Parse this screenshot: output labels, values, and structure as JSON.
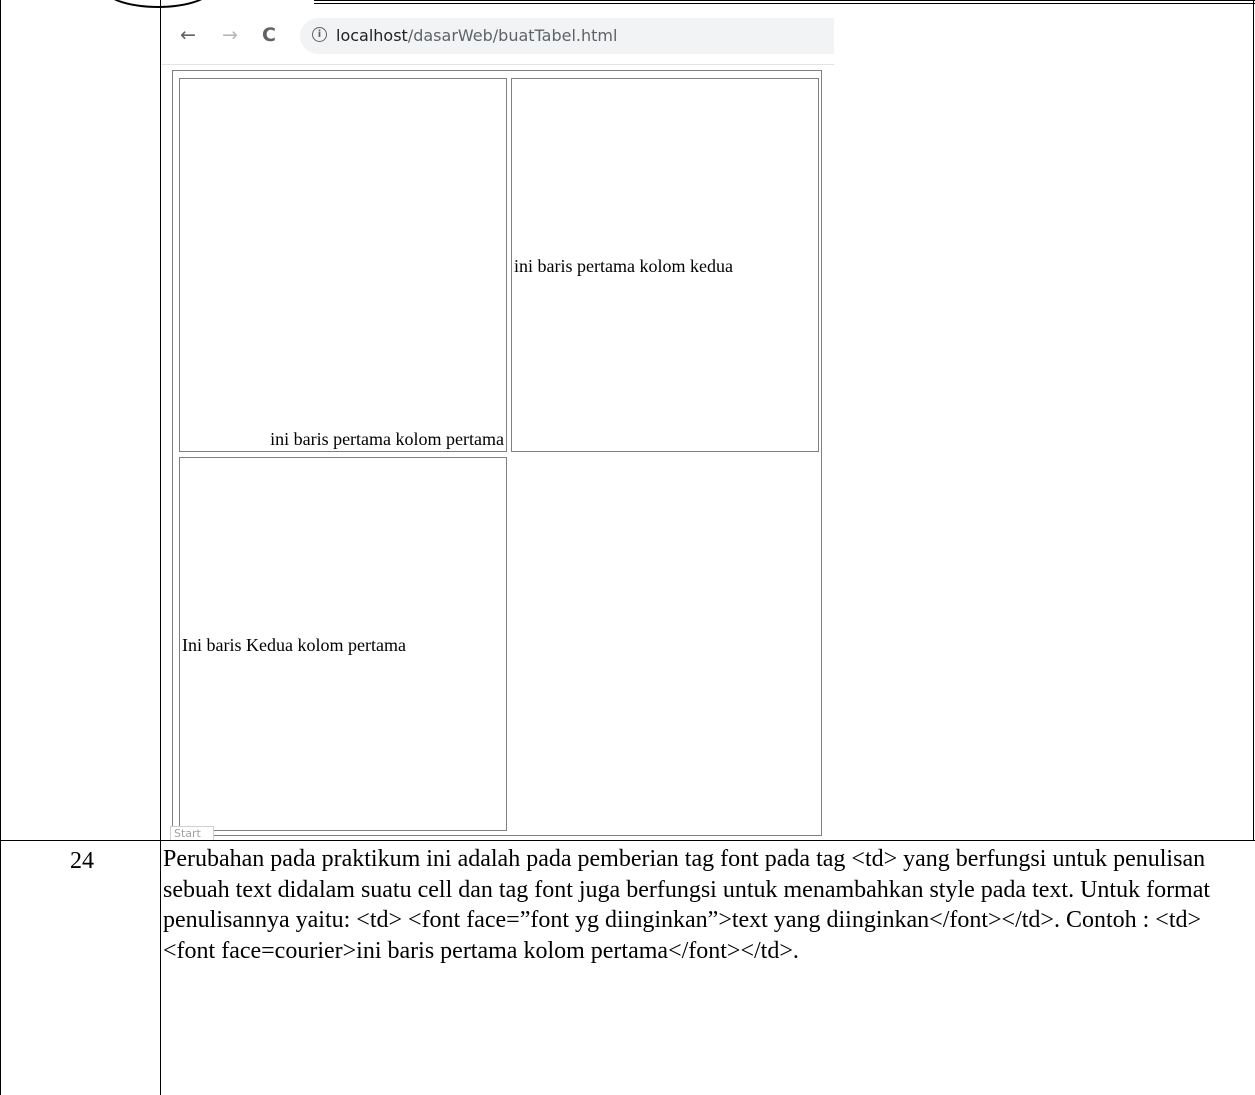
{
  "browser": {
    "nav": {
      "back_icon": "←",
      "forward_icon": "→",
      "reload_icon": "C"
    },
    "info_icon": "i",
    "url_host": "localhost",
    "url_path": "/dasarWeb/buatTabel.html"
  },
  "table": {
    "r1c1": "ini baris pertama kolom pertama",
    "r1c2": "ini baris pertama kolom kedua",
    "r2c1": "Ini baris Kedua kolom pertama"
  },
  "status_text": "Start",
  "row": {
    "number": "24",
    "description": "Perubahan pada praktikum ini adalah pada pemberian tag font pada tag <td> yang berfungsi untuk penulisan sebuah text didalam suatu cell dan tag font juga berfungsi untuk menambahkan style pada text. Untuk format penulisannya yaitu: <td> <font face=”font yg diinginkan”>text yang diinginkan</font></td>. Contoh : <td> <font face=courier>ini baris pertama kolom pertama</font></td>."
  }
}
